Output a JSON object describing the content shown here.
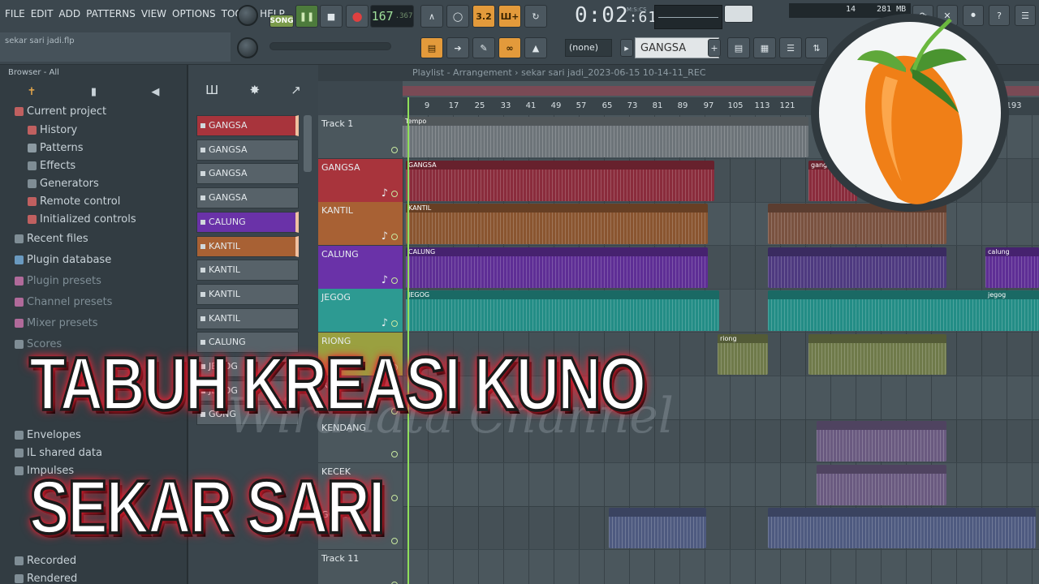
{
  "menu": [
    "FILE",
    "EDIT",
    "ADD",
    "PATTERNS",
    "VIEW",
    "OPTIONS",
    "TOOLS",
    "HELP"
  ],
  "toolbar": {
    "song_label": "SONG",
    "tempo": "167",
    "tempo_fraction": ".367",
    "time_main": "0:02",
    "time_sub": ":61",
    "time_unit": "M:S:CS",
    "snap_number": "3.2",
    "cpu_value": "14",
    "memory": "281 MB",
    "pattern_selector": "(none)",
    "channel_selector": "GANGSA",
    "hint_text": "sekar sari jadi.flp"
  },
  "browser": {
    "header": "Browser - All",
    "items": [
      {
        "label": "Current project",
        "icon": "folder-icon"
      },
      {
        "label": "History",
        "icon": "history-icon"
      },
      {
        "label": "Patterns",
        "icon": "note-icon"
      },
      {
        "label": "Effects",
        "icon": "plug-icon"
      },
      {
        "label": "Generators",
        "icon": "plug-icon"
      },
      {
        "label": "Remote control",
        "icon": "plug-icon"
      },
      {
        "label": "Initialized controls",
        "icon": "plug-icon"
      },
      {
        "label": "Recent files",
        "icon": "folder-icon"
      },
      {
        "label": "Plugin database",
        "icon": "plugin-icon"
      },
      {
        "label": "Plugin presets",
        "icon": "plugin-icon"
      },
      {
        "label": "Channel presets",
        "icon": "plugin-icon"
      },
      {
        "label": "Mixer presets",
        "icon": "plugin-icon"
      },
      {
        "label": "Scores",
        "icon": "note-icon"
      },
      {
        "label": "Envelopes",
        "icon": "folder-icon"
      },
      {
        "label": "IL shared data",
        "icon": "folder-icon"
      },
      {
        "label": "Impulses",
        "icon": "folder-icon"
      },
      {
        "label": "Recorded",
        "icon": "folder-icon"
      },
      {
        "label": "Rendered",
        "icon": "folder-icon"
      }
    ]
  },
  "channels": [
    {
      "label": "GANGSA",
      "color": "#a8343c"
    },
    {
      "label": "GANGSA",
      "color": ""
    },
    {
      "label": "GANGSA",
      "color": ""
    },
    {
      "label": "GANGSA",
      "color": ""
    },
    {
      "label": "CALUNG",
      "color": "#6a32a8"
    },
    {
      "label": "KANTIL",
      "color": "#a86134"
    },
    {
      "label": "KANTIL",
      "color": ""
    },
    {
      "label": "KANTIL",
      "color": ""
    },
    {
      "label": "KANTIL",
      "color": ""
    },
    {
      "label": "CALUNG",
      "color": ""
    },
    {
      "label": "JEGOG",
      "color": ""
    },
    {
      "label": "JEGOG",
      "color": ""
    },
    {
      "label": "GONG",
      "color": ""
    }
  ],
  "playlist": {
    "title": "Playlist - Arrangement",
    "project": "sekar sari jadi_2023-06-15 10-14-11_REC",
    "ruler": [
      "9",
      "17",
      "25",
      "33",
      "41",
      "49",
      "57",
      "65",
      "73",
      "81",
      "89",
      "97",
      "105",
      "113",
      "121",
      "193"
    ],
    "tracks": [
      {
        "label": "Track 1",
        "color": "#4b575d"
      },
      {
        "label": "GANGSA",
        "color": "#a8343c"
      },
      {
        "label": "KANTIL",
        "color": "#a86134"
      },
      {
        "label": "CALUNG",
        "color": "#6a32a8"
      },
      {
        "label": "JEGOG",
        "color": "#2d9a92"
      },
      {
        "label": "RIONG",
        "color": "#9aa040"
      },
      {
        "label": "REONG",
        "color": "#4b575d"
      },
      {
        "label": "KENDANG",
        "color": "#4b575d"
      },
      {
        "label": "KECEK",
        "color": "#4b575d"
      },
      {
        "label": "GONG",
        "color": "#4b575d"
      },
      {
        "label": "Track 11",
        "color": "#4b575d"
      }
    ],
    "clip_labels": {
      "tempo": "Tempo",
      "gangsa": "GANGSA",
      "kantil": "KANTIL",
      "calung": "CALUNG",
      "jegog": "JEGOG",
      "riong": "riong",
      "gangsa_lower": "gangsa",
      "calung_lower": "calung",
      "jegog_lower": "jegog"
    }
  },
  "overlay": {
    "line1": "TABUH KREASI KUNO",
    "line2": "SEKAR SARI",
    "watermark": "Wiranata Channel"
  }
}
